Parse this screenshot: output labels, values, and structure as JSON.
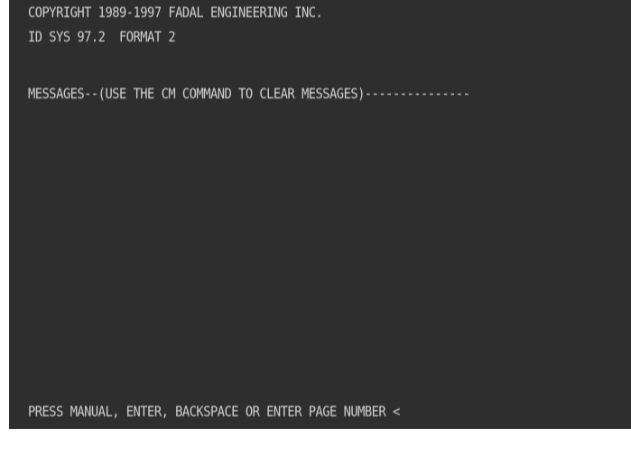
{
  "screen": {
    "copyright": "COPYRIGHT 1989-1997 FADAL ENGINEERING INC.",
    "system_id": "ID SYS 97.2  FORMAT 2",
    "messages_header": "MESSAGES--(USE THE CM COMMAND TO CLEAR MESSAGES)---------------",
    "prompt": "PRESS MANUAL, ENTER, BACKSPACE OR ENTER PAGE NUMBER <"
  },
  "colors": {
    "screen_background": "#2e2e2e",
    "text": "#d2d2d2",
    "frame": "#ffffff"
  }
}
